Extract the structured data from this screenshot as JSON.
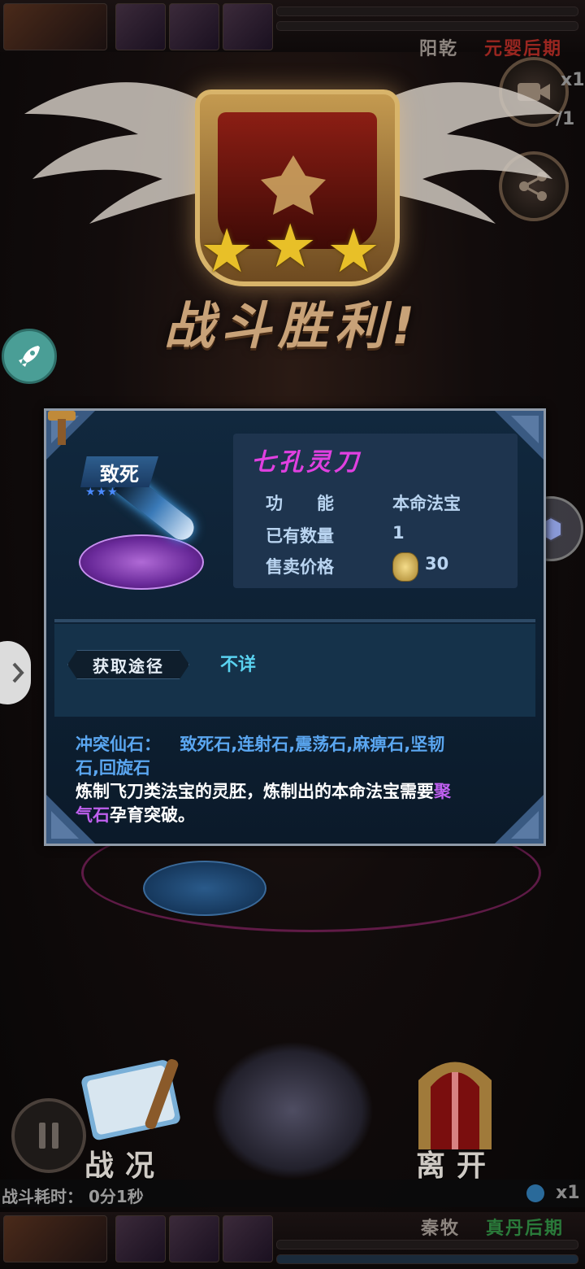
{
  "top": {
    "player_name": "阳乾",
    "player_realm": "元婴后期",
    "count_top": "x1",
    "count_second": "/1"
  },
  "victory": {
    "stars": [
      "★",
      "★",
      "★"
    ],
    "title": "战斗胜利!"
  },
  "item": {
    "badge": "致死",
    "badge_stars": "★★★",
    "name": "七孔灵刀",
    "rows": [
      {
        "label": "功　　能",
        "value": "本命法宝"
      },
      {
        "label": "已有数量",
        "value": "1"
      },
      {
        "label": "售卖价格",
        "value": "30"
      }
    ],
    "source_label": "获取途径",
    "source_value": "不详",
    "conflict_label": "冲突仙石：",
    "conflict_list_1": "致死石,连射石,震荡石,麻痹石,坚韧",
    "conflict_list_2": "石,回旋石",
    "desc_1": "炼制飞刀类法宝的灵胚，炼制出的本命法宝需要",
    "desc_highlight_1": "聚",
    "desc_highlight_2": "气石",
    "desc_2": "孕育突破。"
  },
  "bottom": {
    "battle_label": "战况",
    "leave_label": "离开",
    "battle_time": "战斗耗时：  0分1秒",
    "count": "x1",
    "enemy_name": "秦牧",
    "enemy_realm": "真丹后期"
  },
  "colors": {
    "item_name": "#e040e0",
    "source_value": "#5ad2f0",
    "highlight": "#c060f0"
  }
}
